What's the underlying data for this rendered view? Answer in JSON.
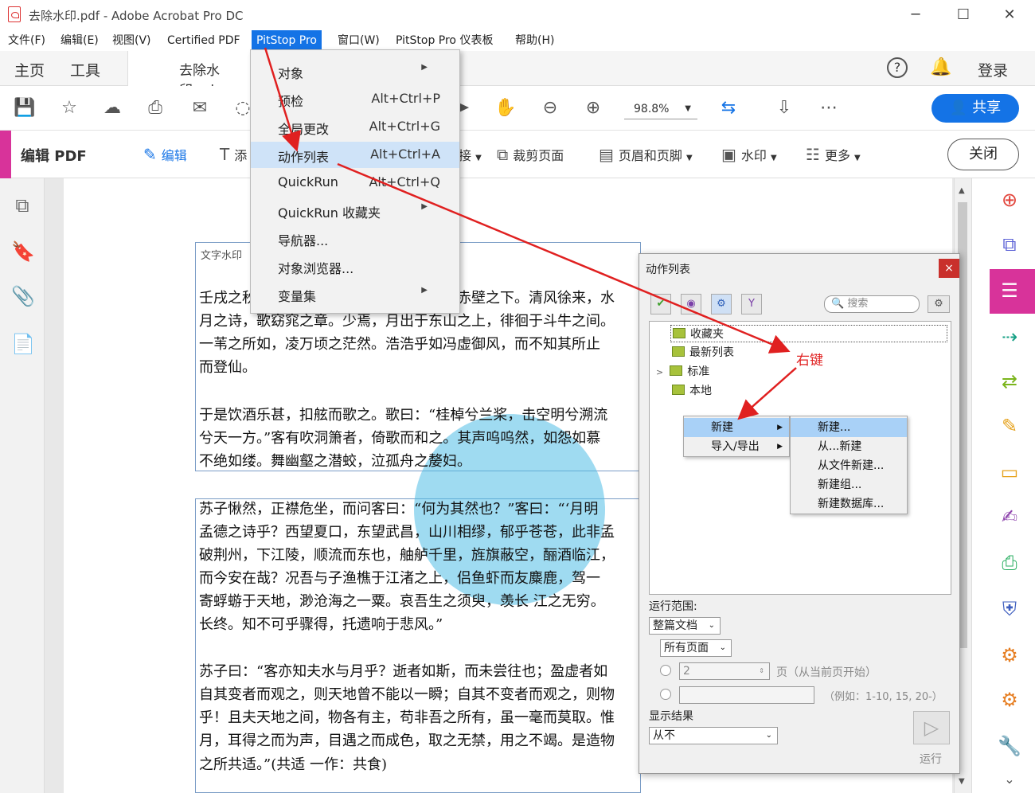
{
  "window": {
    "title": "去除水印.pdf - Adobe Acrobat Pro DC",
    "minimize": "─",
    "maximize": "☐",
    "close": "✕"
  },
  "menubar": [
    "文件(F)",
    "编辑(E)",
    "视图(V)",
    "Certified PDF",
    "PitStop Pro",
    "窗口(W)",
    "PitStop Pro 仪表板",
    "帮助(H)"
  ],
  "tabs": {
    "home": "主页",
    "tools": "工具",
    "document": "去除水印.pd"
  },
  "top_right": {
    "help": "?",
    "login": "登录"
  },
  "toolbar": {
    "zoom": "98.8%",
    "share": "共享"
  },
  "editbar": {
    "title": "编辑 PDF",
    "edit": "编辑",
    "add_text": "添",
    "link": "接",
    "crop": "裁剪页面",
    "header_footer": "页眉和页脚",
    "watermark": "水印",
    "more": "更多",
    "close": "关闭"
  },
  "pitstop_menu": [
    {
      "label": "对象",
      "shortcut": "",
      "submenu": true
    },
    {
      "label": "预检",
      "shortcut": "Alt+Ctrl+P",
      "submenu": false
    },
    {
      "label": "全局更改",
      "shortcut": "Alt+Ctrl+G",
      "submenu": false
    },
    {
      "label": "动作列表",
      "shortcut": "Alt+Ctrl+A",
      "submenu": false
    },
    {
      "label": "QuickRun",
      "shortcut": "Alt+Ctrl+Q",
      "submenu": false
    },
    {
      "label": "QuickRun 收藏夹",
      "shortcut": "",
      "submenu": true
    },
    {
      "label": "导航器...",
      "shortcut": "",
      "submenu": false
    },
    {
      "label": "对象浏览器...",
      "shortcut": "",
      "submenu": false
    },
    {
      "label": "变量集",
      "shortcut": "",
      "submenu": true
    }
  ],
  "document": {
    "watermark_label": "文字水印",
    "paragraphs": [
      "壬戌之秋，七月既望，苏子与客泛舟游于赤壁之下。清风徐来，水",
      "月之诗，歌窈窕之章。少焉，月出于东山之上，徘徊于斗牛之间。",
      "一苇之所如，凌万顷之茫然。浩浩乎如冯虚御风，而不知其所止",
      "而登仙。",
      "于是饮酒乐甚，扣舷而歌之。歌曰：“桂棹兮兰桨，击空明兮溯流",
      "兮天一方。”客有吹洞箫者，倚歌而和之。其声呜呜然，如怨如慕",
      "不绝如缕。舞幽壑之潜蛟，泣孤舟之嫠妇。",
      "苏子愀然，正襟危坐，而问客曰：“何为其然也？”客曰：“‘月明",
      "孟德之诗乎？西望夏口，东望武昌，山川相缪，郁乎苍苍，此非孟",
      "破荆州，下江陵，顺流而东也，舳舻千里，旌旗蔽空，酾酒临江，",
      "而今安在哉？况吾与子渔樵于江渚之上，侣鱼虾而友麋鹿，驾一",
      "寄蜉蝣于天地，渺沧海之一粟。哀吾生之须臾，羡长 江之无穷。",
      "长终。知不可乎骤得，托遗响于悲风。”",
      "苏子曰：“客亦知夫水与月乎？逝者如斯，而未尝往也；盈虚者如",
      "自其变者而观之，则天地曾不能以一瞬；自其不变者而观之，则物",
      "乎！且夫天地之间，物各有主，苟非吾之所有，虽一毫而莫取。惟",
      "月，耳得之而为声，目遇之而成色，取之无禁，用之不竭。是造物",
      "之所共适。”(共适 一作：共食)"
    ]
  },
  "panel": {
    "title": "动作列表",
    "close": "×",
    "search_placeholder": "搜索",
    "tree": [
      "收藏夹",
      "最新列表",
      "标准",
      "本地"
    ],
    "context_menu": [
      "新建",
      "导入/导出"
    ],
    "submenu": [
      "新建...",
      "从...新建",
      "从文件新建...",
      "新建组...",
      "新建数据库..."
    ],
    "run_scope_label": "运行范围:",
    "scope_value": "整篇文档",
    "pages_value": "所有页面",
    "page_count": "2",
    "page_hint": "页（从当前页开始）",
    "range_hint": "（例如：1-10, 15, 20-）",
    "show_result_label": "显示结果",
    "show_result_value": "从不",
    "run": "运行"
  },
  "annotation": {
    "right_click": "右键",
    "color": "#e02020"
  }
}
